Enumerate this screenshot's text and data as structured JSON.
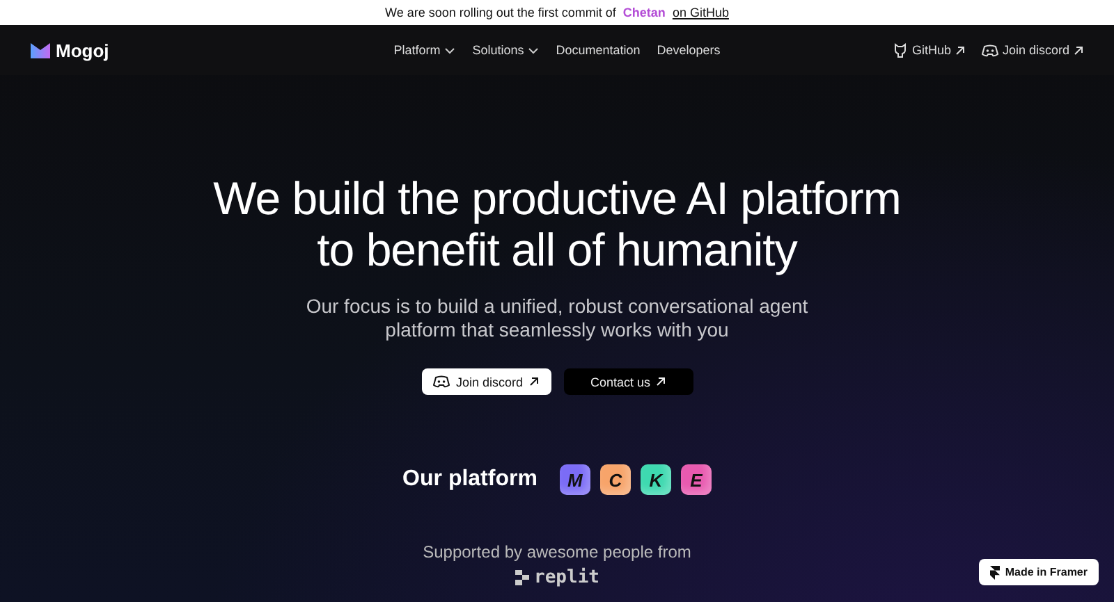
{
  "banner": {
    "text": "We are soon rolling out the first commit of",
    "highlight": "Chetan",
    "link": "on GitHub"
  },
  "nav": {
    "logo": "Mogoj",
    "links": [
      {
        "label": "Platform",
        "dropdown": true
      },
      {
        "label": "Solutions",
        "dropdown": true
      },
      {
        "label": "Documentation",
        "dropdown": false
      },
      {
        "label": "Developers",
        "dropdown": false
      }
    ],
    "actions": [
      {
        "label": "GitHub",
        "kind": "github"
      },
      {
        "label": "Join discord",
        "kind": "discord"
      }
    ]
  },
  "hero": {
    "title_lines": [
      "We build the productive AI platform",
      "to benefit all of humanity"
    ],
    "subtitle_lines": [
      "Our focus is to build a unified, robust conversational agent",
      "platform that seamlessly works with you"
    ],
    "buttons": [
      {
        "label": "Join discord",
        "kind": "light"
      },
      {
        "label": "Contact us",
        "kind": "dark"
      }
    ]
  },
  "platform": {
    "title": "Our platform",
    "apps": [
      {
        "letter": "M",
        "color": "#7b6cf6"
      },
      {
        "letter": "C",
        "color": "#f7a46a"
      },
      {
        "letter": "K",
        "color": "#3ed9b0"
      },
      {
        "letter": "E",
        "color": "#e85ab0"
      }
    ]
  },
  "supporters": {
    "title": "Supported by awesome people from",
    "names": [
      "replit"
    ]
  },
  "badge": {
    "label": "Made in Framer"
  }
}
